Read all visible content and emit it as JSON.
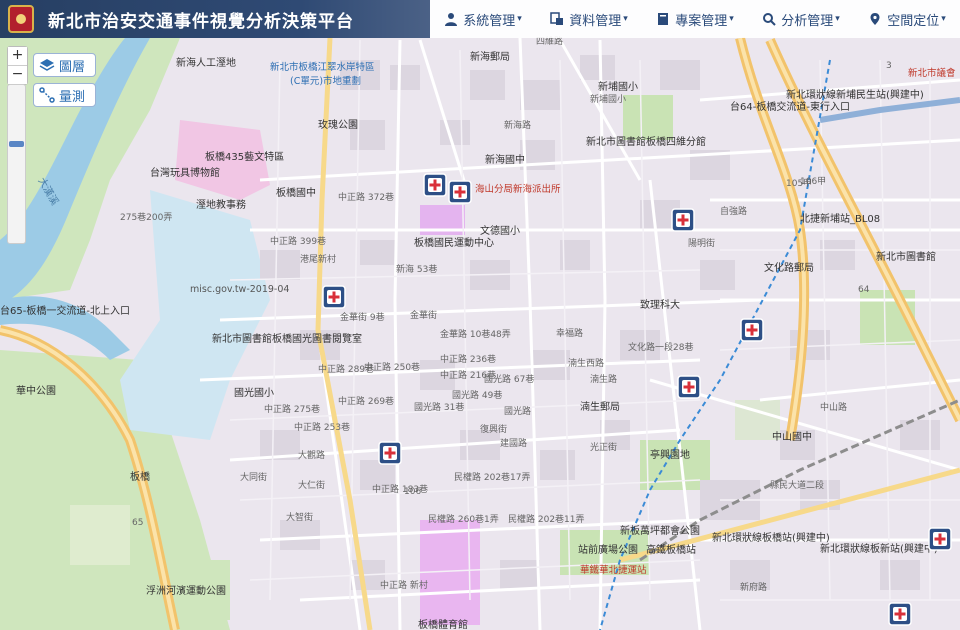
{
  "header": {
    "title": "新北市治安交通事件視覺分析決策平台",
    "menu": [
      {
        "label": "系統管理",
        "icon": "user-icon"
      },
      {
        "label": "資料管理",
        "icon": "data-icon"
      },
      {
        "label": "專案管理",
        "icon": "folder-icon"
      },
      {
        "label": "分析管理",
        "icon": "search-icon"
      },
      {
        "label": "空間定位",
        "icon": "map-pin-icon"
      }
    ]
  },
  "controls": {
    "zoom_in": "+",
    "zoom_out": "−",
    "layers_label": "圖層",
    "measure_label": "量測"
  },
  "map": {
    "watermark": "misc.gov.tw-2019-04",
    "pois": [
      {
        "text": "新海人工溼地"
      },
      {
        "text": "新北市板橋江翠水岸特區"
      },
      {
        "text": "(C單元)市地重劃"
      },
      {
        "text": "玫瑰公園"
      },
      {
        "text": "板橋435藝文特區"
      },
      {
        "text": "台灣玩具博物館"
      },
      {
        "text": "板橋國中"
      },
      {
        "text": "溼地教事務"
      },
      {
        "text": "板橋國民運動中心"
      },
      {
        "text": "文德國小"
      },
      {
        "text": "新海國中"
      },
      {
        "text": "海山分局新海派出所"
      },
      {
        "text": "新北市圖書館板橋四維分館"
      },
      {
        "text": "新埔國小"
      },
      {
        "text": "新海郵局"
      },
      {
        "text": "新北市圖書館板橋國光圖書閱覽室"
      },
      {
        "text": "國光國小"
      },
      {
        "text": "致理科大"
      },
      {
        "text": "湳生郵局"
      },
      {
        "text": "中山國中"
      },
      {
        "text": "亭興園地"
      },
      {
        "text": "新板萬坪都會公園"
      },
      {
        "text": "站前廣場公園"
      },
      {
        "text": "高鐵板橋站"
      },
      {
        "text": "華鐵華北捷運站"
      },
      {
        "text": "浮洲河濱運動公園"
      },
      {
        "text": "板橋體育館"
      },
      {
        "text": "華中公園"
      },
      {
        "text": "新北市議會"
      },
      {
        "text": "新北市圖書館"
      },
      {
        "text": "北捷新埔站_BL08"
      },
      {
        "text": "新北環狀線新埔民生站(興建中)"
      },
      {
        "text": "新北環狀線板橋站(興建中)"
      },
      {
        "text": "新北環狀線板新站(興建中)"
      },
      {
        "text": "文化路郵局"
      },
      {
        "text": "台64-板橋交流道-東行入口"
      },
      {
        "text": "台65-板橋一交流道-北上入口"
      },
      {
        "text": "板橋"
      },
      {
        "text": "大漢溪"
      }
    ],
    "roads": [
      {
        "text": "中正路 372巷"
      },
      {
        "text": "中正路 399巷"
      },
      {
        "text": "中正路 289巷"
      },
      {
        "text": "中正路 269巷"
      },
      {
        "text": "中正路 253巷"
      },
      {
        "text": "中正路 275巷"
      },
      {
        "text": "中正路 236巷"
      },
      {
        "text": "中正路 216巷"
      },
      {
        "text": "中正路 250巷"
      },
      {
        "text": "中正路 183巷"
      },
      {
        "text": "中正路 新村"
      },
      {
        "text": "港尾新村"
      },
      {
        "text": "金華街"
      },
      {
        "text": "金華街 9巷"
      },
      {
        "text": "金華路 10巷48弄"
      },
      {
        "text": "國光路 31巷"
      },
      {
        "text": "國光路 49巷"
      },
      {
        "text": "國光路 67巷"
      },
      {
        "text": "國光路"
      },
      {
        "text": "民權路 202巷17弄"
      },
      {
        "text": "民權路 260巷1弄"
      },
      {
        "text": "民權路 202巷11弄"
      },
      {
        "text": "文化路一段28巷"
      },
      {
        "text": "湳生西路"
      },
      {
        "text": "幸福路"
      },
      {
        "text": "新埔國小"
      },
      {
        "text": "新海路"
      },
      {
        "text": "四維路"
      },
      {
        "text": "陽明街"
      },
      {
        "text": "自強路"
      },
      {
        "text": "縣民大道二段"
      },
      {
        "text": "大觀路"
      },
      {
        "text": "大仁街"
      },
      {
        "text": "大智街"
      },
      {
        "text": "大同街"
      },
      {
        "text": "光正街"
      },
      {
        "text": "復興街"
      },
      {
        "text": "建國路"
      },
      {
        "text": "新府路"
      },
      {
        "text": "中山路"
      },
      {
        "text": "105甲"
      },
      {
        "text": "106甲"
      },
      {
        "text": "106"
      },
      {
        "text": "64"
      },
      {
        "text": "65"
      },
      {
        "text": "3"
      },
      {
        "text": "275巷200弄"
      },
      {
        "text": "湳生路"
      },
      {
        "text": "新海 53巷"
      }
    ],
    "markers": [
      {
        "name": "incident-marker"
      },
      {
        "name": "incident-marker"
      },
      {
        "name": "incident-marker"
      },
      {
        "name": "incident-marker"
      },
      {
        "name": "incident-marker"
      },
      {
        "name": "incident-marker"
      },
      {
        "name": "incident-marker"
      },
      {
        "name": "incident-marker"
      },
      {
        "name": "incident-marker"
      }
    ]
  },
  "colors": {
    "header_bg": "#2f4a74",
    "menu_text": "#2a4a7a",
    "marker_bg": "#2d4f86",
    "marker_cross": "#d9303a",
    "river": "#9ccbe6",
    "highway": "#f2c36b",
    "park": "#c9e3b4"
  }
}
